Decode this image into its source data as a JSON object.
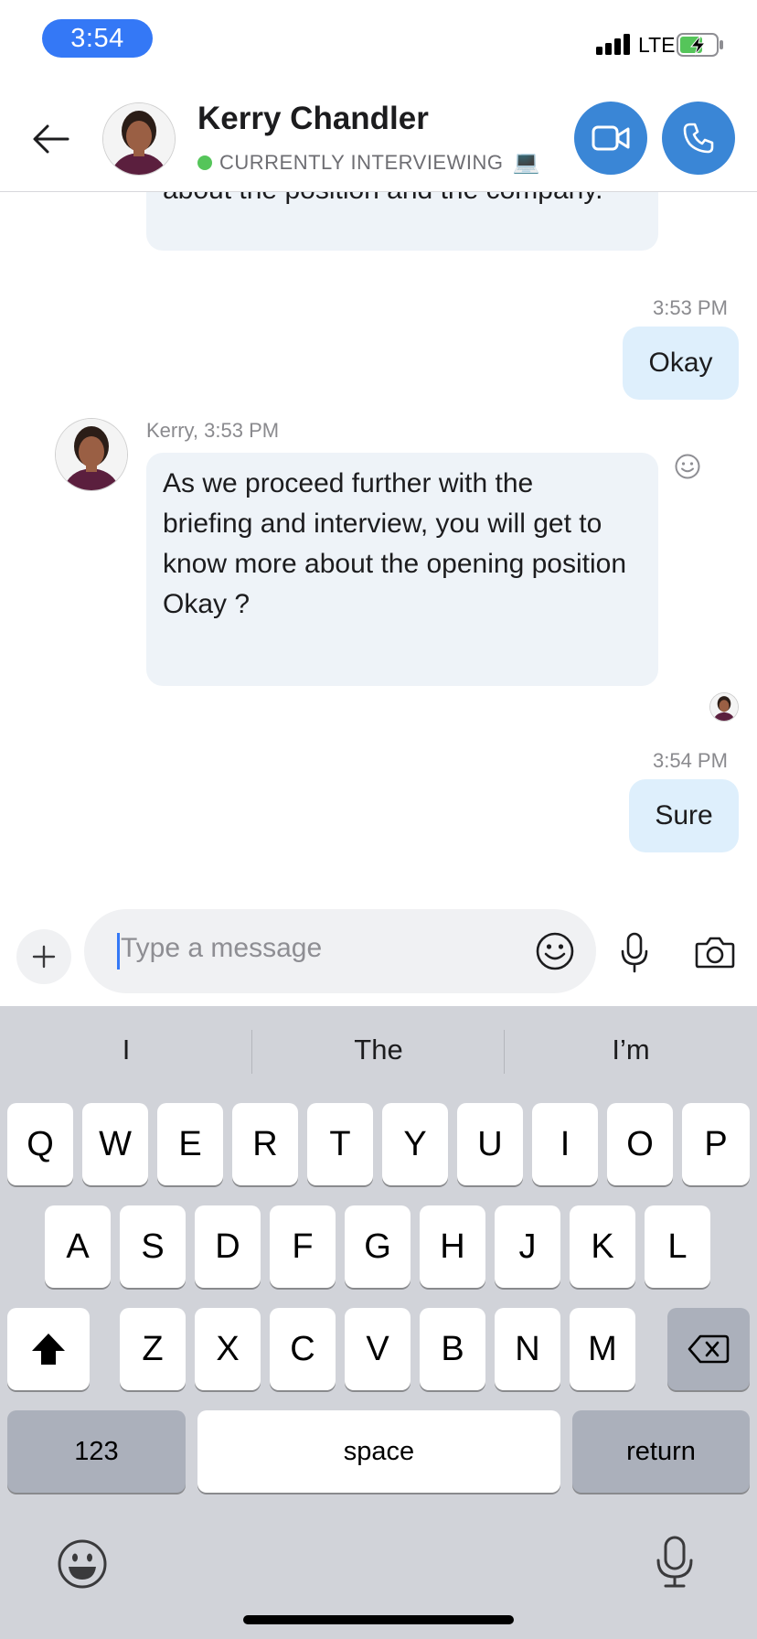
{
  "status_bar": {
    "time": "3:54",
    "network": "LTE",
    "battery_icon": "battery-charging-icon",
    "accent": "#3478f6"
  },
  "header": {
    "contact_name": "Kerry Chandler",
    "presence": "CURRENTLY INTERVIEWING",
    "presence_emoji": "💻",
    "presence_color": "#55c55a",
    "video_call_icon": "video-camera-icon",
    "voice_call_icon": "phone-icon"
  },
  "messages": {
    "incoming_1_text": "about the position and the company.",
    "outgoing_1": {
      "time": "3:53 PM",
      "text": "Okay"
    },
    "incoming_2": {
      "meta": "Kerry, 3:53 PM",
      "text": "As we proceed further with the briefing and interview, you will get to know more about the opening position Okay ?"
    },
    "outgoing_2": {
      "time": "3:54 PM",
      "text": "Sure"
    }
  },
  "composer": {
    "placeholder": "Type a message"
  },
  "keyboard": {
    "suggestions": [
      "I",
      "The",
      "I’m"
    ],
    "row1": [
      "Q",
      "W",
      "E",
      "R",
      "T",
      "Y",
      "U",
      "I",
      "O",
      "P"
    ],
    "row2": [
      "A",
      "S",
      "D",
      "F",
      "G",
      "H",
      "J",
      "K",
      "L"
    ],
    "row3": [
      "Z",
      "X",
      "C",
      "V",
      "B",
      "N",
      "M"
    ],
    "numbers_label": "123",
    "space_label": "space",
    "return_label": "return"
  }
}
